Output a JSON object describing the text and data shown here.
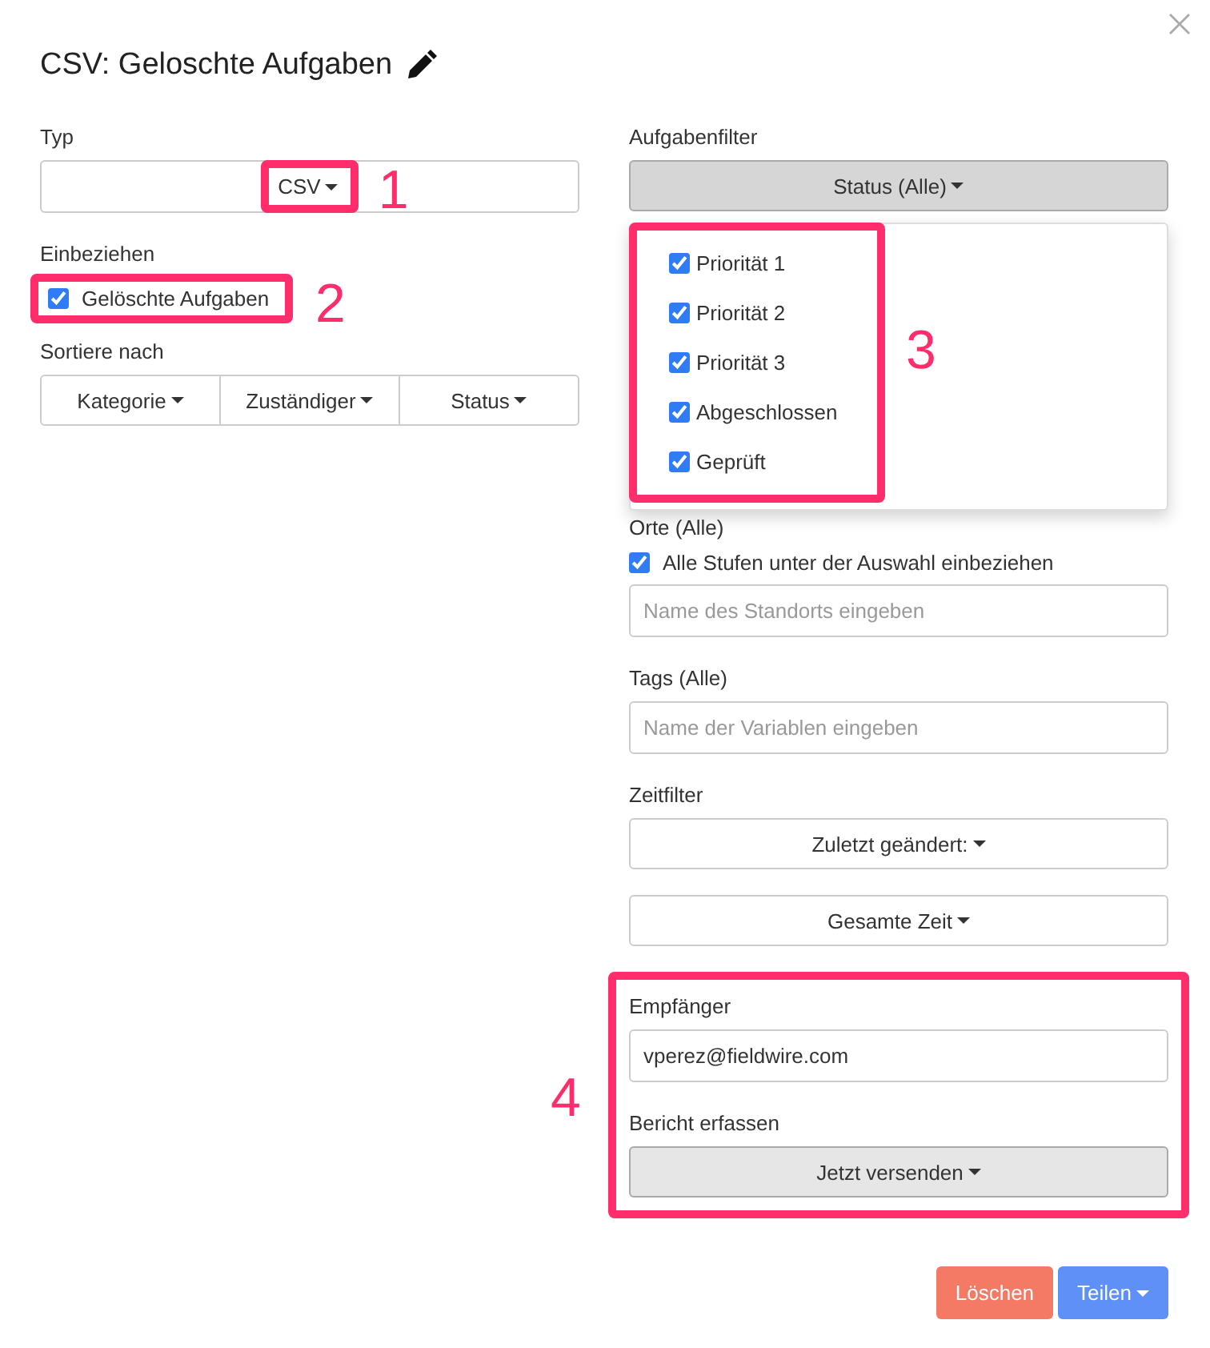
{
  "dialog": {
    "title": "CSV: Geloschte Aufgaben"
  },
  "type": {
    "label": "Typ",
    "value": "CSV",
    "callout": "1"
  },
  "include": {
    "label": "Einbeziehen",
    "option": "Gelöschte Aufgaben",
    "checked": true,
    "callout": "2"
  },
  "sort": {
    "label": "Sortiere nach",
    "buttons": [
      "Kategorie",
      "Zuständiger",
      "Status"
    ]
  },
  "task_filter": {
    "label": "Aufgabenfilter",
    "button": "Status (Alle)",
    "callout": "3",
    "menu": [
      {
        "label": "Priorität 1",
        "checked": true
      },
      {
        "label": "Priorität 2",
        "checked": true
      },
      {
        "label": "Priorität 3",
        "checked": true
      },
      {
        "label": "Abgeschlossen",
        "checked": true
      },
      {
        "label": "Geprüft",
        "checked": true
      }
    ]
  },
  "locations": {
    "label": "Orte (Alle)",
    "option": "Alle Stufen unter der Auswahl einbeziehen",
    "checked": true,
    "placeholder": "Name des Standorts eingeben"
  },
  "tags": {
    "label": "Tags (Alle)",
    "placeholder": "Name der Variablen eingeben"
  },
  "time_filter": {
    "label": "Zeitfilter",
    "buttons": [
      "Zuletzt geändert:",
      "Gesamte Zeit"
    ]
  },
  "recipient": {
    "label": "Empfänger",
    "value": "vperez@fieldwire.com",
    "schedule_label": "Bericht erfassen",
    "schedule_button": "Jetzt versenden",
    "callout": "4"
  },
  "footer": {
    "delete": "Löschen",
    "share": "Teilen"
  }
}
